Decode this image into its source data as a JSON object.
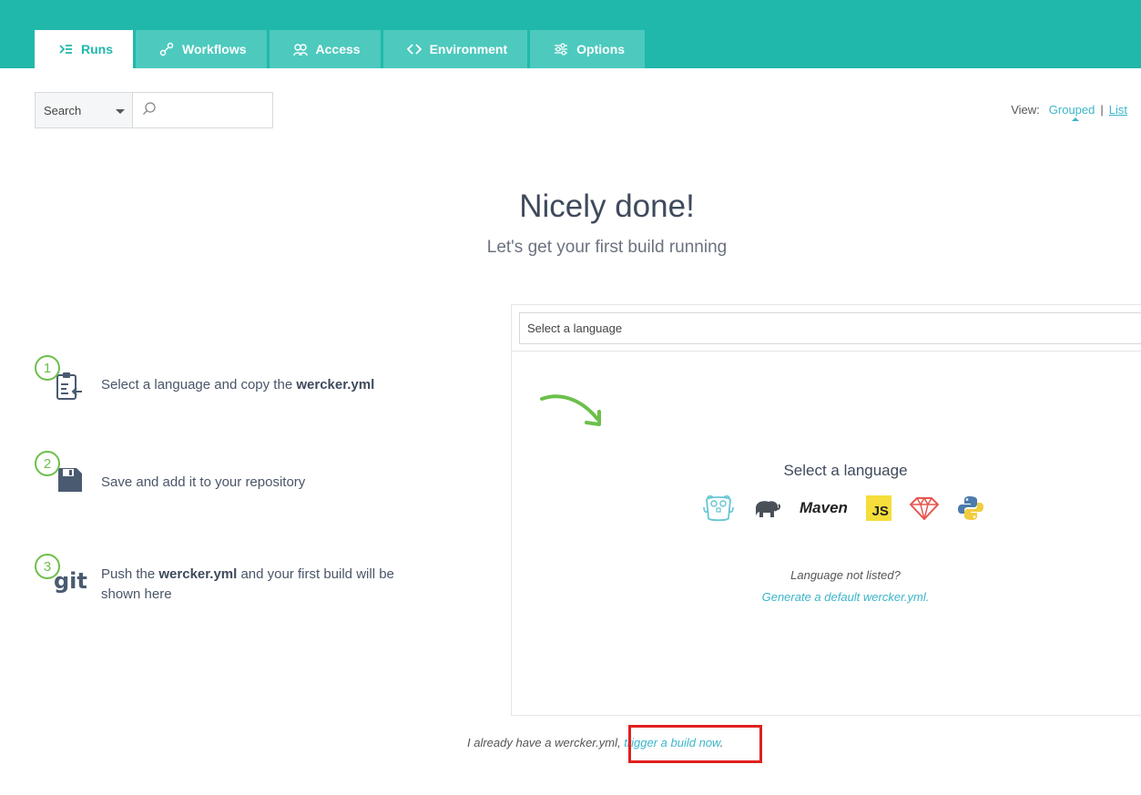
{
  "tabs": [
    {
      "label": "Runs",
      "icon": "runs-icon",
      "active": true
    },
    {
      "label": "Workflows",
      "icon": "workflows-icon"
    },
    {
      "label": "Access",
      "icon": "access-icon"
    },
    {
      "label": "Environment",
      "icon": "code-icon"
    },
    {
      "label": "Options",
      "icon": "options-icon"
    }
  ],
  "search": {
    "select_label": "Search",
    "placeholder": ""
  },
  "view": {
    "label": "View:",
    "grouped": "Grouped",
    "separator": "|",
    "list": "List"
  },
  "hero": {
    "title": "Nicely done!",
    "subtitle": "Let's get your first build running"
  },
  "steps": [
    {
      "number": "1",
      "pre": "Select a language and copy the ",
      "bold": "wercker.yml",
      "post": ""
    },
    {
      "number": "2",
      "pre": "Save and add it to your repository",
      "bold": "",
      "post": ""
    },
    {
      "number": "3",
      "pre": "Push the ",
      "bold": "wercker.yml",
      "post": " and your first build will be shown here"
    }
  ],
  "panel": {
    "select_placeholder": "Select a language",
    "heading": "Select a language",
    "languages": [
      "go-gopher-icon",
      "elephant-icon",
      "Maven",
      "JS",
      "ruby-icon",
      "python-icon"
    ],
    "not_listed": "Language not listed?",
    "generate_link": "Generate a default wercker.yml."
  },
  "footer": {
    "text": "I already have a wercker.yml, ",
    "link": "trigger a build now",
    "end": "."
  },
  "colors": {
    "brand": "#20b8ab",
    "tab_inactive": "#4dc9be",
    "link": "#3bb5c9",
    "step_green": "#6cc04a",
    "highlight": "#e02020"
  }
}
